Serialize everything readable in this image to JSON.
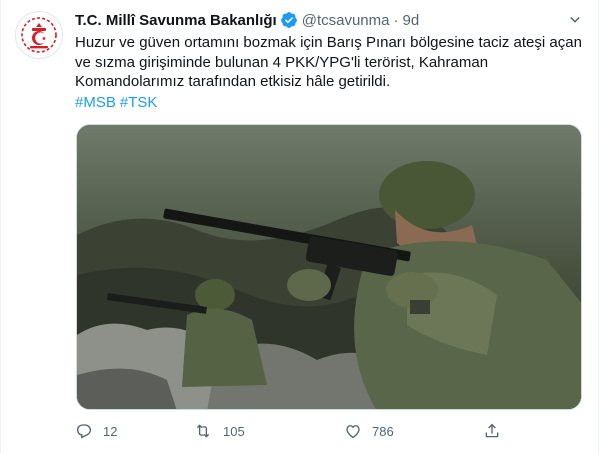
{
  "author": {
    "name": "T.C. Millî Savunma Bakanlığı",
    "handle": "@tcsavunma",
    "separator": "·",
    "time": "9d"
  },
  "tweet": {
    "text_lines": [
      "Huzur ve güven ortamını bozmak için Barış Pınarı bölgesine taciz ateşi açan",
      "ve sızma girişiminde bulunan 4 PKK/YPG'li terörist, Kahraman",
      "Komandolarımız tarafından etkisiz hâle getirildi."
    ],
    "hashtags": [
      "#MSB",
      "#TSK"
    ]
  },
  "actions": {
    "reply_count": "12",
    "retweet_count": "105",
    "like_count": "786"
  },
  "colors": {
    "link": "#1d9bf0",
    "verified": "#1d9bf0",
    "logo_red": "#d0202a",
    "muted": "#536471"
  },
  "icons": [
    "ministry-logo-icon",
    "verified-badge-icon",
    "more-icon",
    "reply-icon",
    "retweet-icon",
    "like-icon",
    "share-icon"
  ]
}
